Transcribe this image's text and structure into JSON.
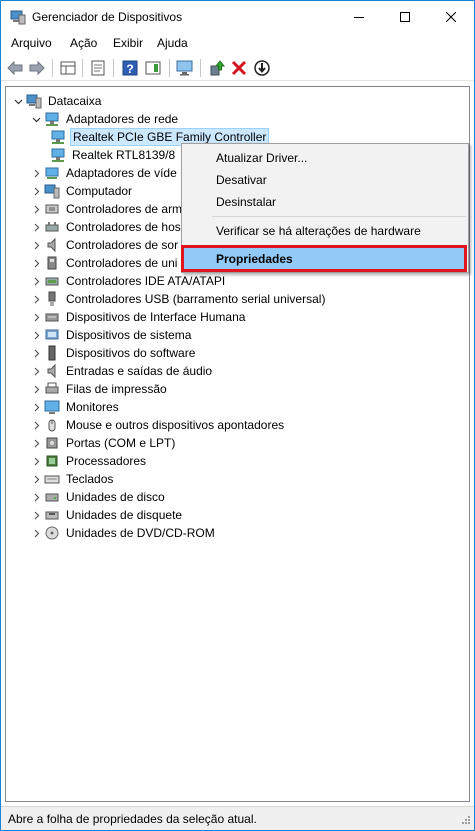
{
  "window": {
    "title": "Gerenciador de Dispositivos"
  },
  "menu": [
    "Arquivo",
    "Ação",
    "Exibir",
    "Ajuda"
  ],
  "toolbar": {
    "icons": [
      "back-arrow-icon",
      "forward-arrow-icon",
      "properties-grid-icon",
      "properties-doc-icon",
      "help-icon",
      "action-pane-icon",
      "monitor-scan-icon",
      "update-driver-icon",
      "uninstall-x-icon",
      "download-circle-icon"
    ]
  },
  "tree": {
    "root": "Datacaixa",
    "network": {
      "label": "Adaptadores de rede",
      "children": [
        "Realtek PCIe GBE Family Controller",
        "Realtek RTL8139/8"
      ]
    },
    "categories": [
      "Adaptadores de víde",
      "Computador",
      "Controladores de arm",
      "Controladores de hos",
      "Controladores de sor",
      "Controladores de uni",
      "Controladores IDE ATA/ATAPI",
      "Controladores USB (barramento serial universal)",
      "Dispositivos de Interface Humana",
      "Dispositivos de sistema",
      "Dispositivos do software",
      "Entradas e saídas de áudio",
      "Filas de impressão",
      "Monitores",
      "Mouse e outros dispositivos apontadores",
      "Portas (COM e LPT)",
      "Processadores",
      "Teclados",
      "Unidades de disco",
      "Unidades de disquete",
      "Unidades de DVD/CD-ROM"
    ]
  },
  "context_menu": {
    "update": "Atualizar Driver...",
    "disable": "Desativar",
    "uninstall": "Desinstalar",
    "scan": "Verificar se há alterações de hardware",
    "properties": "Propriedades"
  },
  "status": "Abre a folha de propriedades da seleção atual.",
  "colors": {
    "highlight": "#91c9f7",
    "selection": "#cce8ff",
    "red_box": "#e0161f",
    "window_border": "#1883d7"
  }
}
